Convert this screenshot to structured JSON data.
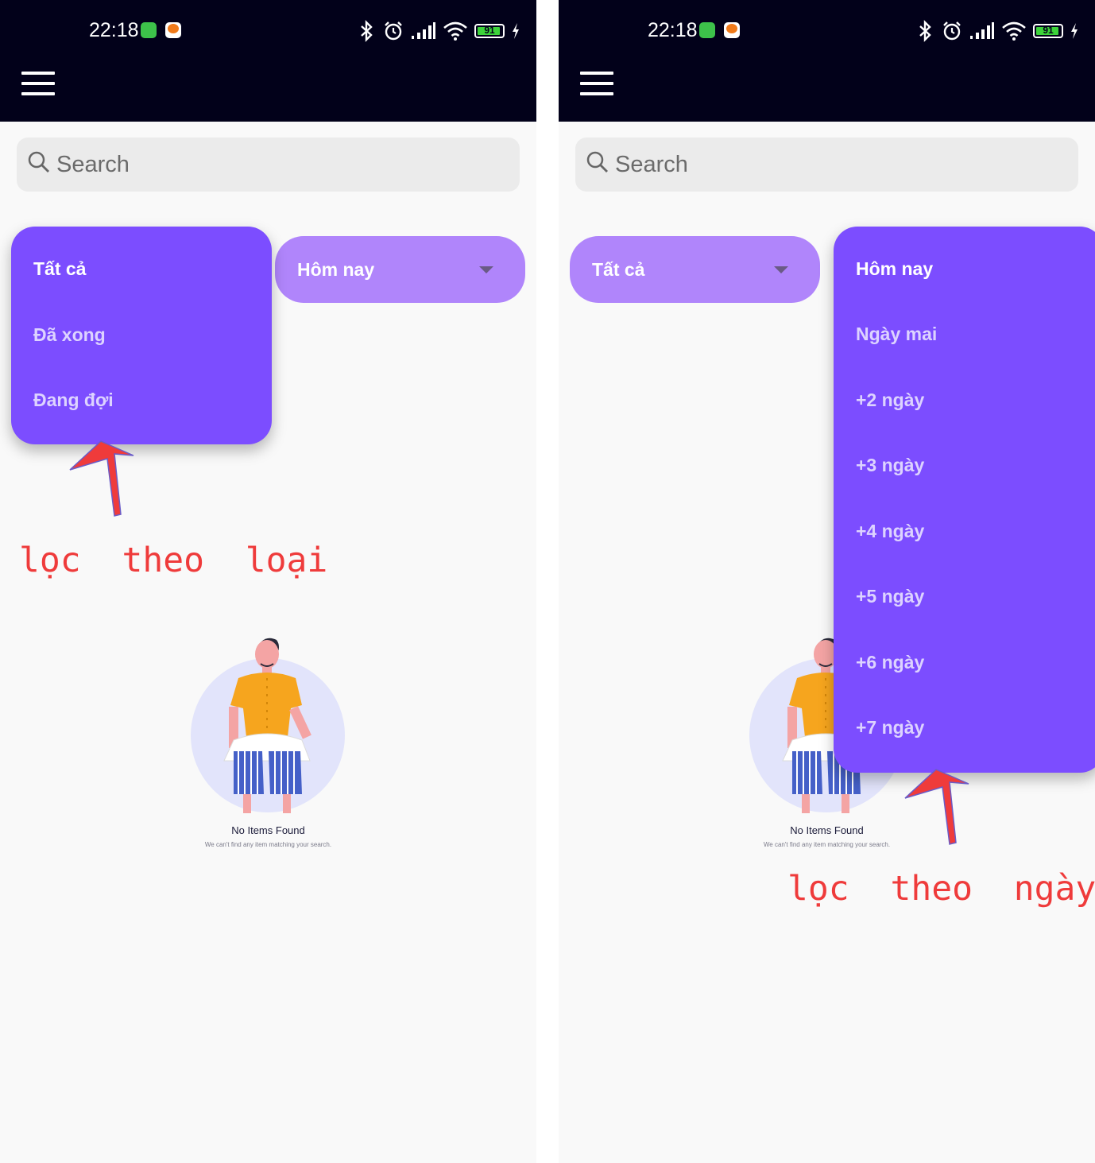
{
  "status_bar": {
    "time": "22:18",
    "battery_level": "91",
    "colors": {
      "bar_bg": "#02011a",
      "battery_fill": "#3dd33a"
    }
  },
  "search": {
    "placeholder": "Search"
  },
  "left_screen": {
    "type_filter": {
      "selected": "Tất cả",
      "options": [
        "Tất cả",
        "Đã xong",
        "Đang đợi"
      ]
    },
    "date_filter": {
      "value": "Hôm nay"
    },
    "annotation": "lọc  theo  loại"
  },
  "right_screen": {
    "type_filter": {
      "value": "Tất cả"
    },
    "date_filter": {
      "selected": "Hôm nay",
      "options": [
        "Hôm nay",
        "Ngày mai",
        "+2 ngày",
        "+3 ngày",
        "+4 ngày",
        "+5 ngày",
        "+6 ngày",
        "+7 ngày"
      ]
    },
    "annotation": "lọc  theo  ngày"
  },
  "empty_state": {
    "title": "No Items Found",
    "subtitle": "We can't find any item matching your search."
  },
  "colors": {
    "accent": "#7c4dff",
    "pill": "#b085fb",
    "annotation": "#ef3b3b"
  }
}
